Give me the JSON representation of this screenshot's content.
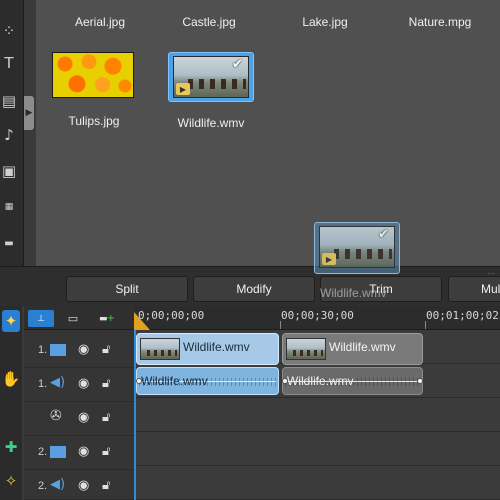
{
  "library": {
    "items": [
      {
        "label": "Aerial.jpg"
      },
      {
        "label": "Castle.jpg"
      },
      {
        "label": "Lake.jpg"
      },
      {
        "label": "Nature.mpg"
      },
      {
        "label": "Tulips.jpg"
      },
      {
        "label": "Wildlife.wmv",
        "selected": true
      }
    ]
  },
  "drag": {
    "label": "Wildlife.wmv"
  },
  "action_bar": {
    "split": "Split",
    "modify": "Modify",
    "trim": "Trim",
    "multi": "Mul"
  },
  "timeline": {
    "ruler": [
      "0;00;00;00",
      "00;00;30;00",
      "00;01;00;02"
    ],
    "tracks": [
      {
        "number": "1.",
        "kind": "video"
      },
      {
        "number": "1.",
        "kind": "audio"
      },
      {
        "number": "",
        "kind": "effect"
      },
      {
        "number": "2.",
        "kind": "video"
      },
      {
        "number": "2.",
        "kind": "audio"
      }
    ],
    "clips": {
      "video_selected": "Wildlife.wmv",
      "video": "Wildlife.wmv",
      "audio_selected": "Wildlife.wmv",
      "audio": "Wildlife.wmv"
    }
  },
  "colors": {
    "accent": "#2a8fd8",
    "selection": "#4aa3e8",
    "panel": "#505050",
    "toolbar": "#2e2e2e"
  }
}
